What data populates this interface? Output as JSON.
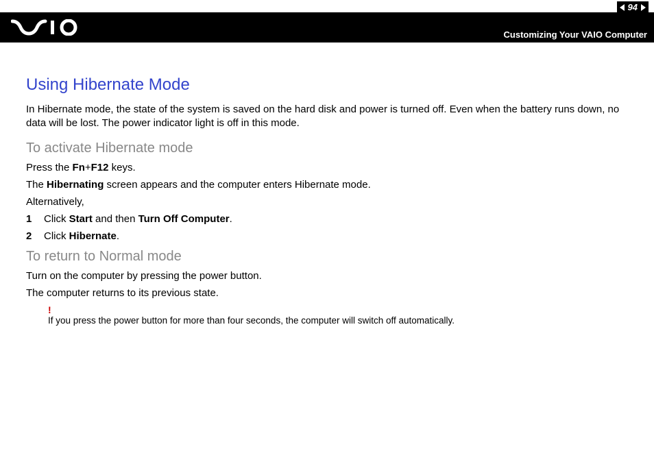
{
  "header": {
    "page_number": "94",
    "breadcrumb": "Customizing Your VAIO Computer"
  },
  "content": {
    "title": "Using Hibernate Mode",
    "intro": "In Hibernate mode, the state of the system is saved on the hard disk and power is turned off. Even when the battery runs down, no data will be lost. The power indicator light is off in this mode.",
    "subA": "To activate Hibernate mode",
    "lineA1_a": "Press the ",
    "lineA1_b": "Fn",
    "lineA1_c": "+",
    "lineA1_d": "F12",
    "lineA1_e": " keys.",
    "lineA2_a": "The ",
    "lineA2_b": "Hibernating",
    "lineA2_c": " screen appears and the computer enters Hibernate mode.",
    "lineA3": "Alternatively,",
    "step1_num": "1",
    "step1_a": "Click ",
    "step1_b": "Start",
    "step1_c": " and then ",
    "step1_d": "Turn Off Computer",
    "step1_e": ".",
    "step2_num": "2",
    "step2_a": "Click ",
    "step2_b": "Hibernate",
    "step2_c": ".",
    "subB": "To return to Normal mode",
    "lineB1": "Turn on the computer by pressing the power button.",
    "lineB2": "The computer returns to its previous state.",
    "warn_mark": "!",
    "warn_text": "If you press the power button for more than four seconds, the computer will switch off automatically."
  }
}
